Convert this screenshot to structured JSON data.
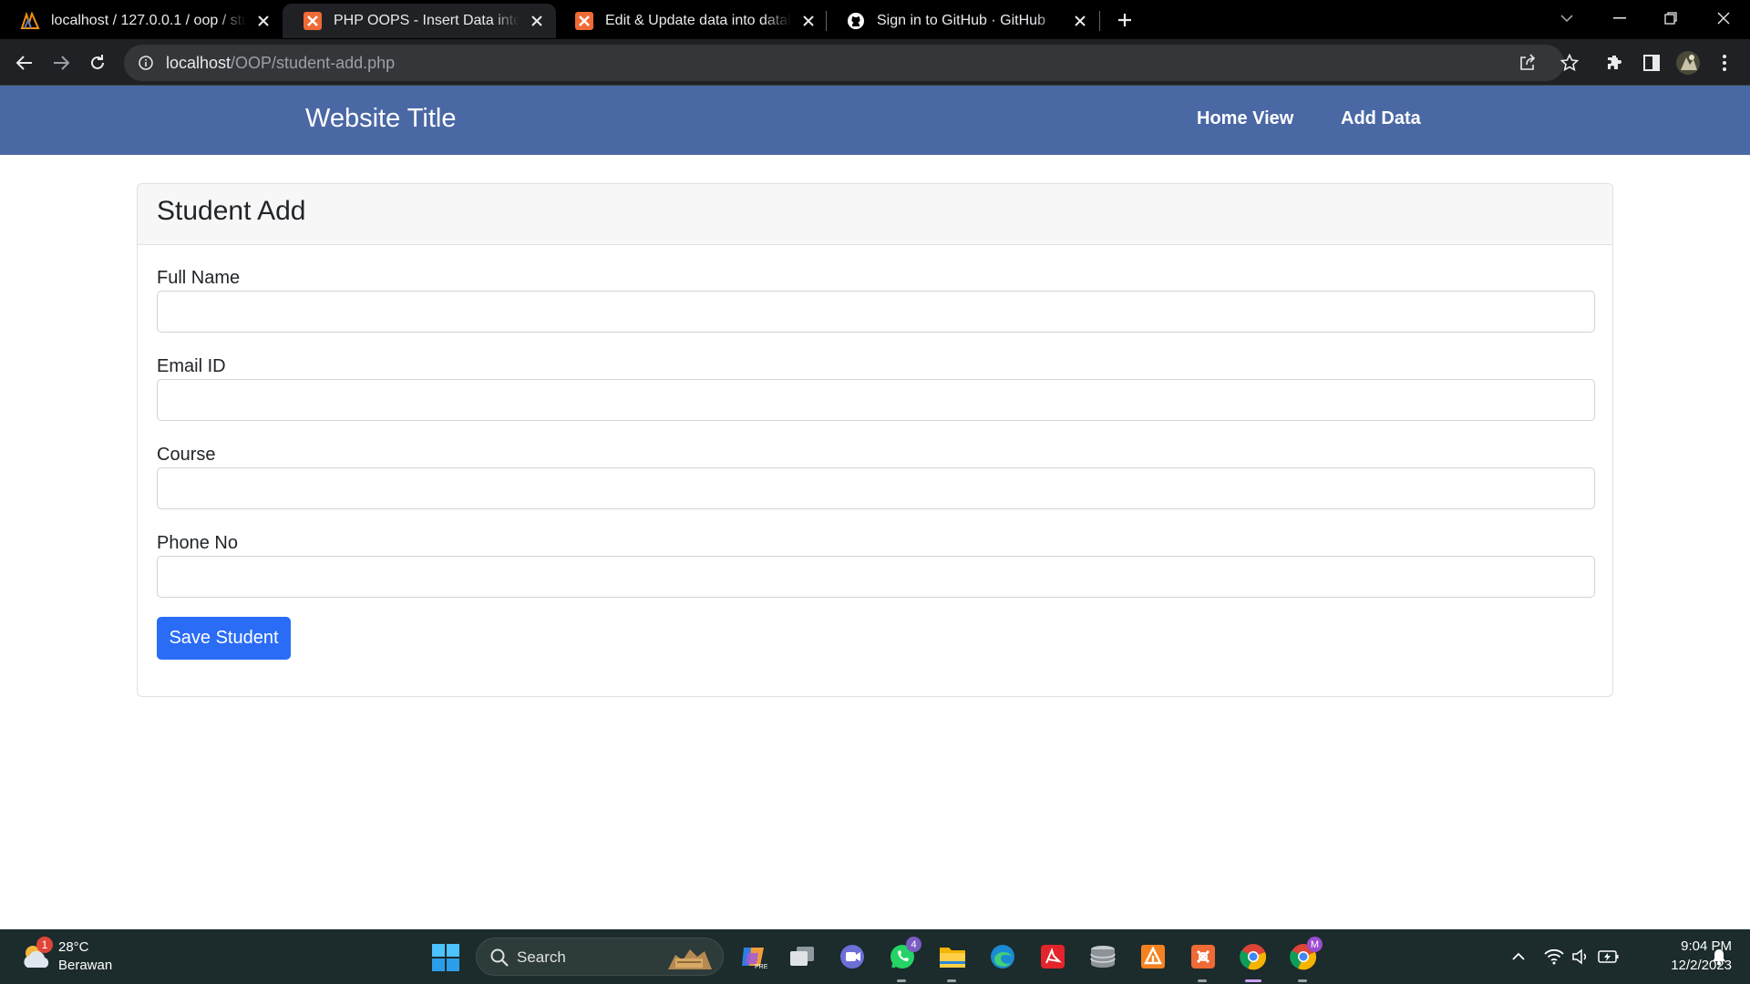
{
  "browser": {
    "tabs": [
      {
        "title": "localhost / 127.0.0.1 / oop / stud",
        "favicon": "phpmyadmin-icon",
        "active": false
      },
      {
        "title": "PHP OOPS - Insert Data into dat",
        "favicon": "xampp-icon",
        "active": true
      },
      {
        "title": "Edit & Update data into databas",
        "favicon": "xampp-icon",
        "active": false
      },
      {
        "title": "Sign in to GitHub · GitHub",
        "favicon": "github-icon",
        "active": false
      }
    ],
    "url_host": "localhost",
    "url_path": "/OOP/student-add.php"
  },
  "site": {
    "title": "Website Title",
    "nav": {
      "home": "Home View",
      "add": "Add Data"
    },
    "nav_color": "#4a68a4"
  },
  "form": {
    "heading": "Student Add",
    "fields": [
      {
        "label": "Full Name",
        "value": ""
      },
      {
        "label": "Email ID",
        "value": ""
      },
      {
        "label": "Course",
        "value": ""
      },
      {
        "label": "Phone No",
        "value": ""
      }
    ],
    "submit_label": "Save Student",
    "submit_color": "#2a6cf6"
  },
  "taskbar": {
    "weather": {
      "temp": "28°C",
      "condition": "Berawan",
      "badge": "1"
    },
    "search_label": "Search",
    "whatsapp_badge": "4",
    "profile_badge": "M",
    "time": "9:04 PM",
    "date": "12/2/2023"
  }
}
